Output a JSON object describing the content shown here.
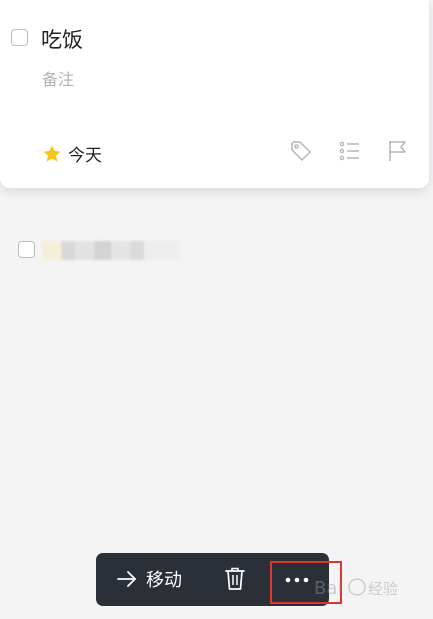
{
  "task": {
    "title": "吃饭",
    "note_placeholder": "备注",
    "date_label": "今天"
  },
  "toolbar": {
    "move_label": "移动"
  },
  "icons": {
    "star": "star-icon",
    "tag": "tag-icon",
    "list": "checklist-icon",
    "flag": "flag-icon",
    "arrow": "arrow-right-icon",
    "trash": "trash-icon",
    "more": "more-dots-icon"
  },
  "colors": {
    "star": "#f5c518",
    "toolbar_bg": "#2b2f38",
    "highlight": "#e2332f"
  }
}
